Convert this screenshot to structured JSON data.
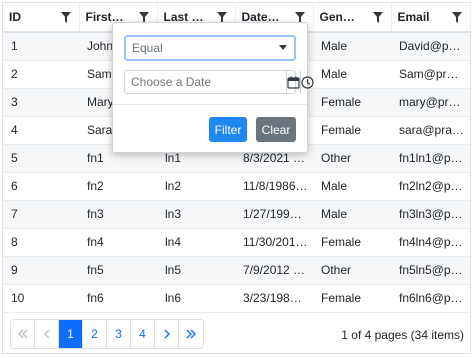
{
  "columns": [
    {
      "label": "ID"
    },
    {
      "label": "First…"
    },
    {
      "label": "Last …"
    },
    {
      "label": "Date…"
    },
    {
      "label": "Gen…"
    },
    {
      "label": "Email"
    }
  ],
  "rows": [
    [
      "1",
      "John",
      "",
      "",
      "Male",
      "David@p…"
    ],
    [
      "2",
      "Sam",
      "",
      "",
      "Male",
      "Sam@pr…"
    ],
    [
      "3",
      "Mary",
      "",
      "",
      "Female",
      "mary@pr…"
    ],
    [
      "4",
      "Sara",
      "",
      "",
      "Female",
      "sara@pra…"
    ],
    [
      "5",
      "fn1",
      "ln1",
      "8/3/2021 …",
      "Other",
      "fn1ln1@p…"
    ],
    [
      "6",
      "fn2",
      "ln2",
      "11/8/1986…",
      "Male",
      "fn2ln2@p…"
    ],
    [
      "7",
      "fn3",
      "ln3",
      "1/27/199…",
      "Male",
      "fn3ln3@p…"
    ],
    [
      "8",
      "fn4",
      "ln4",
      "11/30/201…",
      "Female",
      "fn4ln4@p…"
    ],
    [
      "9",
      "fn5",
      "ln5",
      "7/9/2012 …",
      "Other",
      "fn5ln5@p…"
    ],
    [
      "10",
      "fn6",
      "ln6",
      "3/23/198…",
      "Female",
      "fn6ln6@p…"
    ]
  ],
  "pager": {
    "pages": [
      "1",
      "2",
      "3",
      "4"
    ],
    "current": "1",
    "info": "1 of 4 pages (34 items)"
  },
  "filter_popup": {
    "operator": "Equal",
    "date_placeholder": "Choose a Date",
    "filter_label": "Filter",
    "clear_label": "Clear"
  },
  "icons": {
    "column_filter": "funnel-icon",
    "select_caret": "caret-down-icon",
    "calendar": "calendar-icon",
    "clock": "clock-icon",
    "first": "double-chevron-left-icon",
    "prev": "chevron-left-icon",
    "next": "chevron-right-icon",
    "last": "double-chevron-right-icon"
  },
  "colors": {
    "accent": "#0d6efd",
    "filter_button": "#1f87f0",
    "clear_button": "#6c757d",
    "stripe": "#f6f7f8"
  }
}
